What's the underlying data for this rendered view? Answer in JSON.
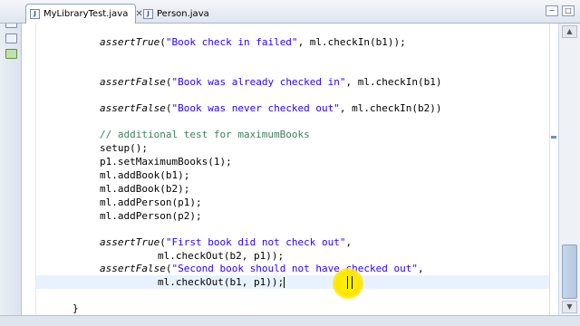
{
  "tabs": [
    {
      "label": "MyLibraryTest.java",
      "active": true,
      "close": "✕"
    },
    {
      "label": "Person.java",
      "active": false
    }
  ],
  "window_buttons": [
    "−",
    "□"
  ],
  "code": {
    "line1_kw": "assertTrue",
    "line1_a": "(",
    "line1_str": "\"Book check in failed\"",
    "line1_b": ", ml.checkIn(b1));",
    "line2_kw": "assertFalse",
    "line2_a": "(",
    "line2_str": "\"Book was already checked in\"",
    "line2_b": ", ml.checkIn(b1)",
    "line3_kw": "assertFalse",
    "line3_a": "(",
    "line3_str": "\"Book was never checked out\"",
    "line3_b": ", ml.checkIn(b2))",
    "line4_com": "// additional test for maximumBooks",
    "line5": "setup();",
    "line6": "p1.setMaximumBooks(1);",
    "line7": "ml.addBook(b1);",
    "line8": "ml.addBook(b2);",
    "line9": "ml.addPerson(p1);",
    "line10": "ml.addPerson(p2);",
    "line11_kw": "assertTrue",
    "line11_a": "(",
    "line11_str": "\"First book did not check out\"",
    "line11_b": ",",
    "line12": "ml.checkOut(b2, p1));",
    "line13_kw": "assertFalse",
    "line13_a": "(",
    "line13_str": "\"Second book should not have checked out\"",
    "line13_b": ",",
    "line14": "ml.checkOut(b1, p1));",
    "line15": "}"
  },
  "scroll_arrows": {
    "up": "▲",
    "down": "▼"
  },
  "colors": {
    "string": "#2a00ff",
    "comment": "#3f7f5f",
    "current_line": "#e8f2fe",
    "highlight": "#fff200"
  }
}
